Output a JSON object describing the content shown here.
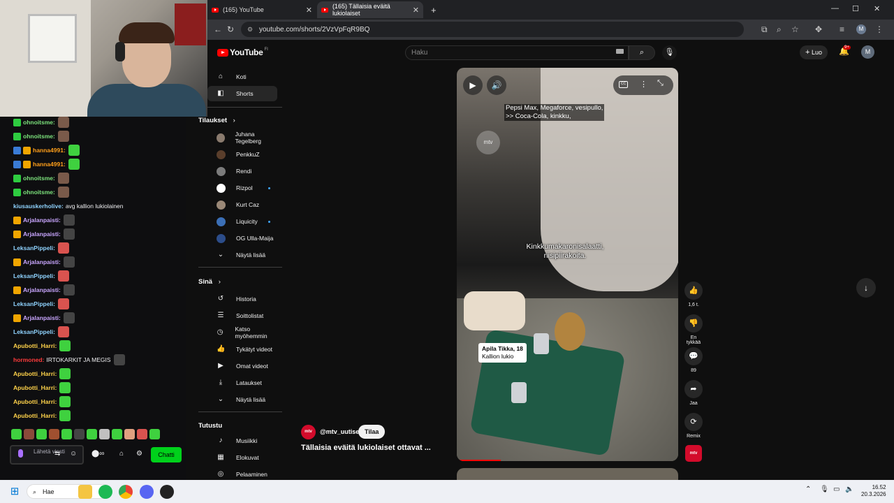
{
  "browser": {
    "tabs": [
      {
        "title": "(165) YouTube"
      },
      {
        "title": "(165) Tällaisia eväitä lukiolaiset"
      }
    ],
    "url": "youtube.com/shorts/2VzVpFqR9BQ",
    "profile_letter": "M"
  },
  "youtube": {
    "logo_text": "YouTube",
    "logo_region": "FI",
    "search_placeholder": "Haku",
    "create_label": "Luo",
    "notif_count": "9+",
    "avatar_letter": "M",
    "sidebar": {
      "main": [
        {
          "label": "Koti",
          "icon": "home-icon"
        },
        {
          "label": "Shorts",
          "icon": "shorts-icon",
          "active": true
        }
      ],
      "subscriptions_header": "Tilaukset",
      "subscriptions": [
        {
          "label": "Juhana Tegelberg",
          "dot": false,
          "color": "#8a7b6e"
        },
        {
          "label": "PenkkuZ",
          "dot": false,
          "color": "#5a3e2b"
        },
        {
          "label": "Rendi",
          "dot": false,
          "color": "#7c7c7c"
        },
        {
          "label": "Rizpol",
          "dot": true,
          "color": "#ffffff"
        },
        {
          "label": "Kurt Caz",
          "dot": false,
          "color": "#9a8877"
        },
        {
          "label": "Liquicity",
          "dot": true,
          "color": "#3b6fb6"
        },
        {
          "label": "OG Ulla-Maija",
          "dot": false,
          "color": "#2c4d8a"
        }
      ],
      "show_more": "Näytä lisää",
      "you_header": "Sinä",
      "you_items": [
        {
          "label": "Historia",
          "icon": "history-icon"
        },
        {
          "label": "Soittolistat",
          "icon": "playlist-icon"
        },
        {
          "label": "Katso myöhemmin",
          "icon": "clock-icon"
        },
        {
          "label": "Tykätyt videot",
          "icon": "thumbs-up-icon"
        },
        {
          "label": "Omat videot",
          "icon": "video-icon"
        },
        {
          "label": "Lataukset",
          "icon": "download-icon"
        }
      ],
      "show_more_2": "Näytä lisää",
      "explore_header": "Tutustu",
      "explore_items": [
        {
          "label": "Musiikki",
          "icon": "music-icon"
        },
        {
          "label": "Elokuvat",
          "icon": "film-icon"
        },
        {
          "label": "Pelaaminen",
          "icon": "gamepad-icon"
        }
      ]
    },
    "short": {
      "caption_top_1": "Pepsi Max, Megaforce, vesipullo,",
      "caption_top_2": ">> Coca-Cola, kinkku,",
      "caption_mid_1": "Kinkkumakaronisalaatti,",
      "caption_mid_2": "riisipiirakoita.",
      "name_tag_1": "Apila Tikka, 18",
      "name_tag_2": "Kallion lukio",
      "watermark": "mtv",
      "channel_handle": "@mtv_uutiset",
      "channel_avatar_text": "mtv",
      "subscribe_label": "Tilaa",
      "title": "Tällaisia eväitä lukiolaiset ottavat ...",
      "progress": 0.2
    },
    "actions": [
      {
        "icon": "thumbs-up-icon",
        "label": "1,6 t."
      },
      {
        "icon": "thumbs-down-icon",
        "label": "En tykkää"
      },
      {
        "icon": "comment-icon",
        "label": "89"
      },
      {
        "icon": "share-icon",
        "label": "Jaa"
      },
      {
        "icon": "remix-icon",
        "label": "Remix"
      }
    ]
  },
  "chat": {
    "messages": [
      {
        "user": "ohnoitsme:",
        "color": "#7ce27c",
        "text": "",
        "badges": [
          "#2ecc40"
        ],
        "emote": "#7a5a4a"
      },
      {
        "user": "ohnoitsme:",
        "color": "#7ce27c",
        "text": "",
        "badges": [
          "#2ecc40"
        ],
        "emote": "#7a5a4a"
      },
      {
        "user": "hanna4991:",
        "color": "#ff9f1a",
        "text": "",
        "badges": [
          "#3a7bd5",
          "#f0a500"
        ],
        "emote": "#3fd13f"
      },
      {
        "user": "hanna4991:",
        "color": "#ff9f1a",
        "text": "",
        "badges": [
          "#3a7bd5",
          "#f0a500"
        ],
        "emote": "#3fd13f"
      },
      {
        "user": "ohnoitsme:",
        "color": "#7ce27c",
        "text": "",
        "badges": [
          "#2ecc40"
        ],
        "emote": "#7a5a4a"
      },
      {
        "user": "ohnoitsme:",
        "color": "#7ce27c",
        "text": "",
        "badges": [
          "#2ecc40"
        ],
        "emote": "#7a5a4a"
      },
      {
        "user": "kiusauskerholive:",
        "color": "#8fd3ff",
        "text": "avg kallion lukiolainen",
        "badges": [],
        "emote": ""
      },
      {
        "user": "Arjalanpaisti:",
        "color": "#c9a6ff",
        "text": "",
        "badges": [
          "#f0a500"
        ],
        "emote": "#444444"
      },
      {
        "user": "Arjalanpaisti:",
        "color": "#c9a6ff",
        "text": "",
        "badges": [
          "#f0a500"
        ],
        "emote": "#444444"
      },
      {
        "user": "LeksanPippeli:",
        "color": "#8fd3ff",
        "text": "",
        "badges": [],
        "emote": "#d9534f"
      },
      {
        "user": "Arjalanpaisti:",
        "color": "#c9a6ff",
        "text": "",
        "badges": [
          "#f0a500"
        ],
        "emote": "#444444"
      },
      {
        "user": "LeksanPippeli:",
        "color": "#8fd3ff",
        "text": "",
        "badges": [],
        "emote": "#d9534f"
      },
      {
        "user": "Arjalanpaisti:",
        "color": "#c9a6ff",
        "text": "",
        "badges": [
          "#f0a500"
        ],
        "emote": "#444444"
      },
      {
        "user": "LeksanPippeli:",
        "color": "#8fd3ff",
        "text": "",
        "badges": [],
        "emote": "#d9534f"
      },
      {
        "user": "Arjalanpaisti:",
        "color": "#c9a6ff",
        "text": "",
        "badges": [
          "#f0a500"
        ],
        "emote": "#444444"
      },
      {
        "user": "LeksanPippeli:",
        "color": "#8fd3ff",
        "text": "",
        "badges": [],
        "emote": "#d9534f"
      },
      {
        "user": "Apubotti_Harri:",
        "color": "#ffd24a",
        "text": "",
        "badges": [],
        "emote": "#3fd13f"
      },
      {
        "user": "hormoned:",
        "color": "#ff3b3b",
        "text": "IRTOKARKIT JA MEGIS",
        "badges": [],
        "emote": "#444444"
      },
      {
        "user": "Apubotti_Harri:",
        "color": "#ffd24a",
        "text": "",
        "badges": [],
        "emote": "#3fd13f"
      },
      {
        "user": "Apubotti_Harri:",
        "color": "#ffd24a",
        "text": "",
        "badges": [],
        "emote": "#3fd13f"
      },
      {
        "user": "Apubotti_Harri:",
        "color": "#ffd24a",
        "text": "",
        "badges": [],
        "emote": "#3fd13f"
      },
      {
        "user": "Apubotti_Harri:",
        "color": "#ffd24a",
        "text": "",
        "badges": [],
        "emote": "#3fd13f"
      }
    ],
    "input_placeholder": "Lähetä viesti",
    "send_label": "Chatti"
  },
  "taskbar": {
    "search_label": "Hae",
    "time": "16.52",
    "date": "20.3.2026"
  }
}
